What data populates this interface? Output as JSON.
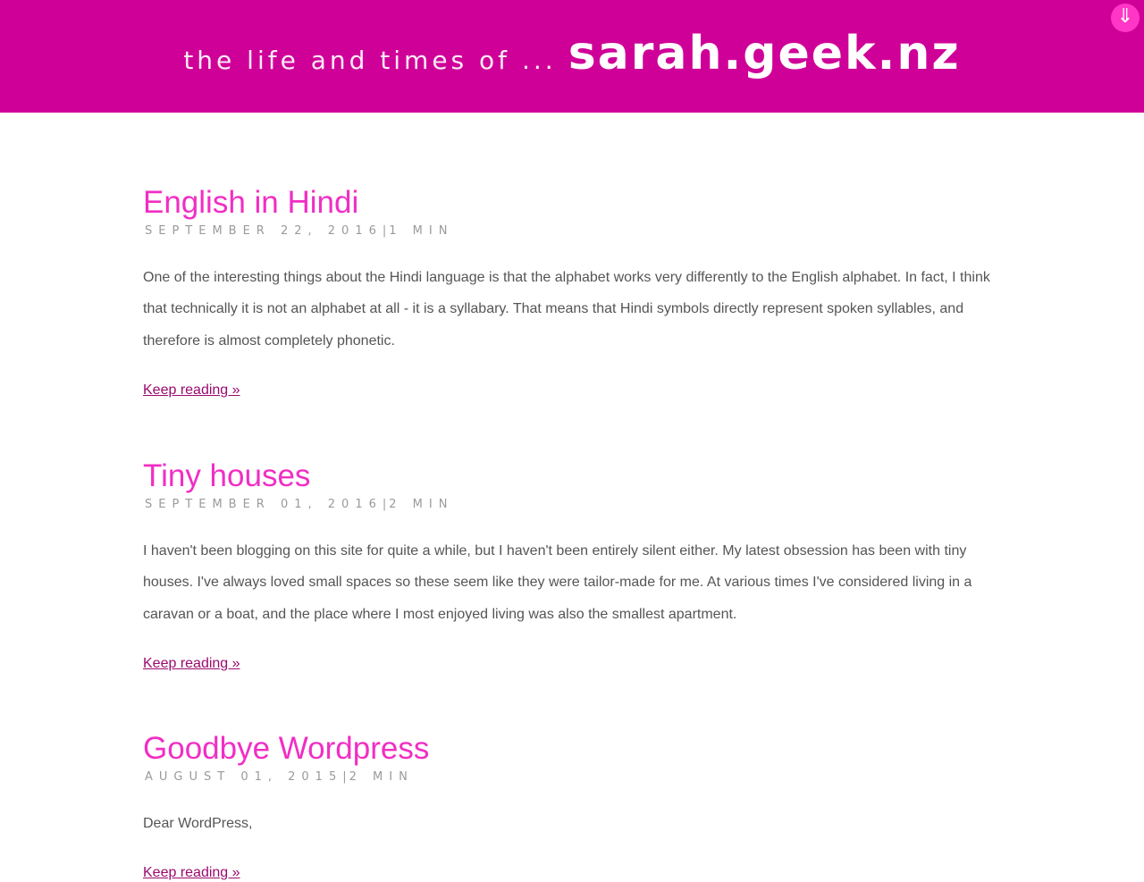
{
  "header": {
    "tagline": "the life and times of ...",
    "site_name": "sarah.geek.nz",
    "menu_icon": "down-arrow-icon"
  },
  "posts": [
    {
      "title": "English in Hindi",
      "date": "SEPTEMBER 22, 2016",
      "separator": "|",
      "read_time": "1 MIN",
      "excerpt": "One of the interesting things about the Hindi language is that the alphabet works very differently to the English alphabet. In fact, I think that technically it is not an alphabet at all - it is a syllabary. That means that Hindi symbols directly represent spoken syllables, and therefore is almost completely phonetic.",
      "read_more": "Keep reading »"
    },
    {
      "title": "Tiny houses",
      "date": "SEPTEMBER 01, 2016",
      "separator": "|",
      "read_time": "2 MIN",
      "excerpt": "I haven't been blogging on this site for quite a while, but I haven't been entirely silent either. My latest obsession has been with tiny houses. I've always loved small spaces so these seem like they were tailor-made for me. At various times I've considered living in a caravan or a boat, and the place where I most enjoyed living was also the smallest apartment.",
      "read_more": "Keep reading »"
    },
    {
      "title": "Goodbye Wordpress",
      "date": "AUGUST 01, 2015",
      "separator": "|",
      "read_time": "2 MIN",
      "excerpt": "Dear WordPress,",
      "read_more": "Keep reading »"
    }
  ],
  "colors": {
    "header_bg": "#cf0098",
    "title": "#f12ec4",
    "link": "#9a0a6e",
    "menu_button": "#ff36c6"
  }
}
